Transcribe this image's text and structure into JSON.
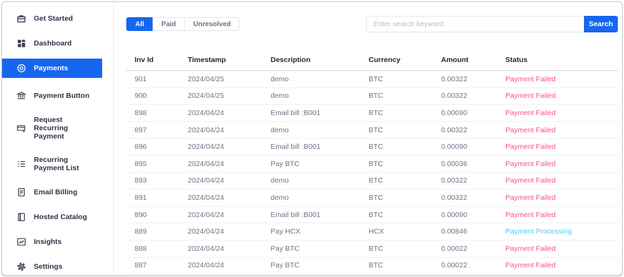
{
  "sidebar": {
    "items": [
      {
        "label": "Get Started",
        "icon": "briefcase-icon",
        "active": false
      },
      {
        "label": "Dashboard",
        "icon": "dashboard-grid-icon",
        "active": false
      },
      {
        "label": "Payments",
        "icon": "coin-icon",
        "active": true
      },
      {
        "label": "Payment Button",
        "icon": "bank-icon",
        "active": false
      },
      {
        "label": "Request Recurring Payment",
        "icon": "card-plus-icon",
        "active": false
      },
      {
        "label": "Recurring Payment List",
        "icon": "list-icon",
        "active": false
      },
      {
        "label": "Email Billing",
        "icon": "document-icon",
        "active": false
      },
      {
        "label": "Hosted Catalog",
        "icon": "book-icon",
        "active": false
      },
      {
        "label": "Insights",
        "icon": "chart-icon",
        "active": false
      },
      {
        "label": "Settings",
        "icon": "gear-icon",
        "active": false
      }
    ]
  },
  "toolbar": {
    "filters": [
      {
        "label": "All",
        "active": true
      },
      {
        "label": "Paid",
        "active": false
      },
      {
        "label": "Unresolved",
        "active": false
      }
    ],
    "search": {
      "placeholder": "Enter search keyword",
      "button_label": "Search"
    }
  },
  "table": {
    "columns": [
      "Inv Id",
      "Timestamp",
      "Description",
      "Currency",
      "Amount",
      "Status"
    ],
    "rows": [
      {
        "inv_id": "901",
        "timestamp": "2024/04/25",
        "description": "demo",
        "currency": "BTC",
        "amount": "0.00322",
        "status": "Payment Failed",
        "status_type": "failed"
      },
      {
        "inv_id": "900",
        "timestamp": "2024/04/25",
        "description": "demo",
        "currency": "BTC",
        "amount": "0.00322",
        "status": "Payment Failed",
        "status_type": "failed"
      },
      {
        "inv_id": "898",
        "timestamp": "2024/04/24",
        "description": "Email bill :B001",
        "currency": "BTC",
        "amount": "0.00090",
        "status": "Payment Failed",
        "status_type": "failed"
      },
      {
        "inv_id": "897",
        "timestamp": "2024/04/24",
        "description": "demo",
        "currency": "BTC",
        "amount": "0.00322",
        "status": "Payment Failed",
        "status_type": "failed"
      },
      {
        "inv_id": "896",
        "timestamp": "2024/04/24",
        "description": "Email bill :B001",
        "currency": "BTC",
        "amount": "0.00090",
        "status": "Payment Failed",
        "status_type": "failed"
      },
      {
        "inv_id": "895",
        "timestamp": "2024/04/24",
        "description": "Pay BTC",
        "currency": "BTC",
        "amount": "0.00036",
        "status": "Payment Failed",
        "status_type": "failed"
      },
      {
        "inv_id": "893",
        "timestamp": "2024/04/24",
        "description": "demo",
        "currency": "BTC",
        "amount": "0.00322",
        "status": "Payment Failed",
        "status_type": "failed"
      },
      {
        "inv_id": "891",
        "timestamp": "2024/04/24",
        "description": "demo",
        "currency": "BTC",
        "amount": "0.00322",
        "status": "Payment Failed",
        "status_type": "failed"
      },
      {
        "inv_id": "890",
        "timestamp": "2024/04/24",
        "description": "Email bill :B001",
        "currency": "BTC",
        "amount": "0.00090",
        "status": "Payment Failed",
        "status_type": "failed"
      },
      {
        "inv_id": "889",
        "timestamp": "2024/04/24",
        "description": "Pay HCX",
        "currency": "HCX",
        "amount": "0.00846",
        "status": "Payment Processing",
        "status_type": "processing"
      },
      {
        "inv_id": "888",
        "timestamp": "2024/04/24",
        "description": "Pay BTC",
        "currency": "BTC",
        "amount": "0.00022",
        "status": "Payment Failed",
        "status_type": "failed"
      },
      {
        "inv_id": "887",
        "timestamp": "2024/04/24",
        "description": "Pay BTC",
        "currency": "BTC",
        "amount": "0.00022",
        "status": "Payment Failed",
        "status_type": "failed"
      }
    ]
  },
  "colors": {
    "primary": "#1766f0",
    "status_failed": "#f4547c",
    "status_processing": "#4fc9f4"
  }
}
